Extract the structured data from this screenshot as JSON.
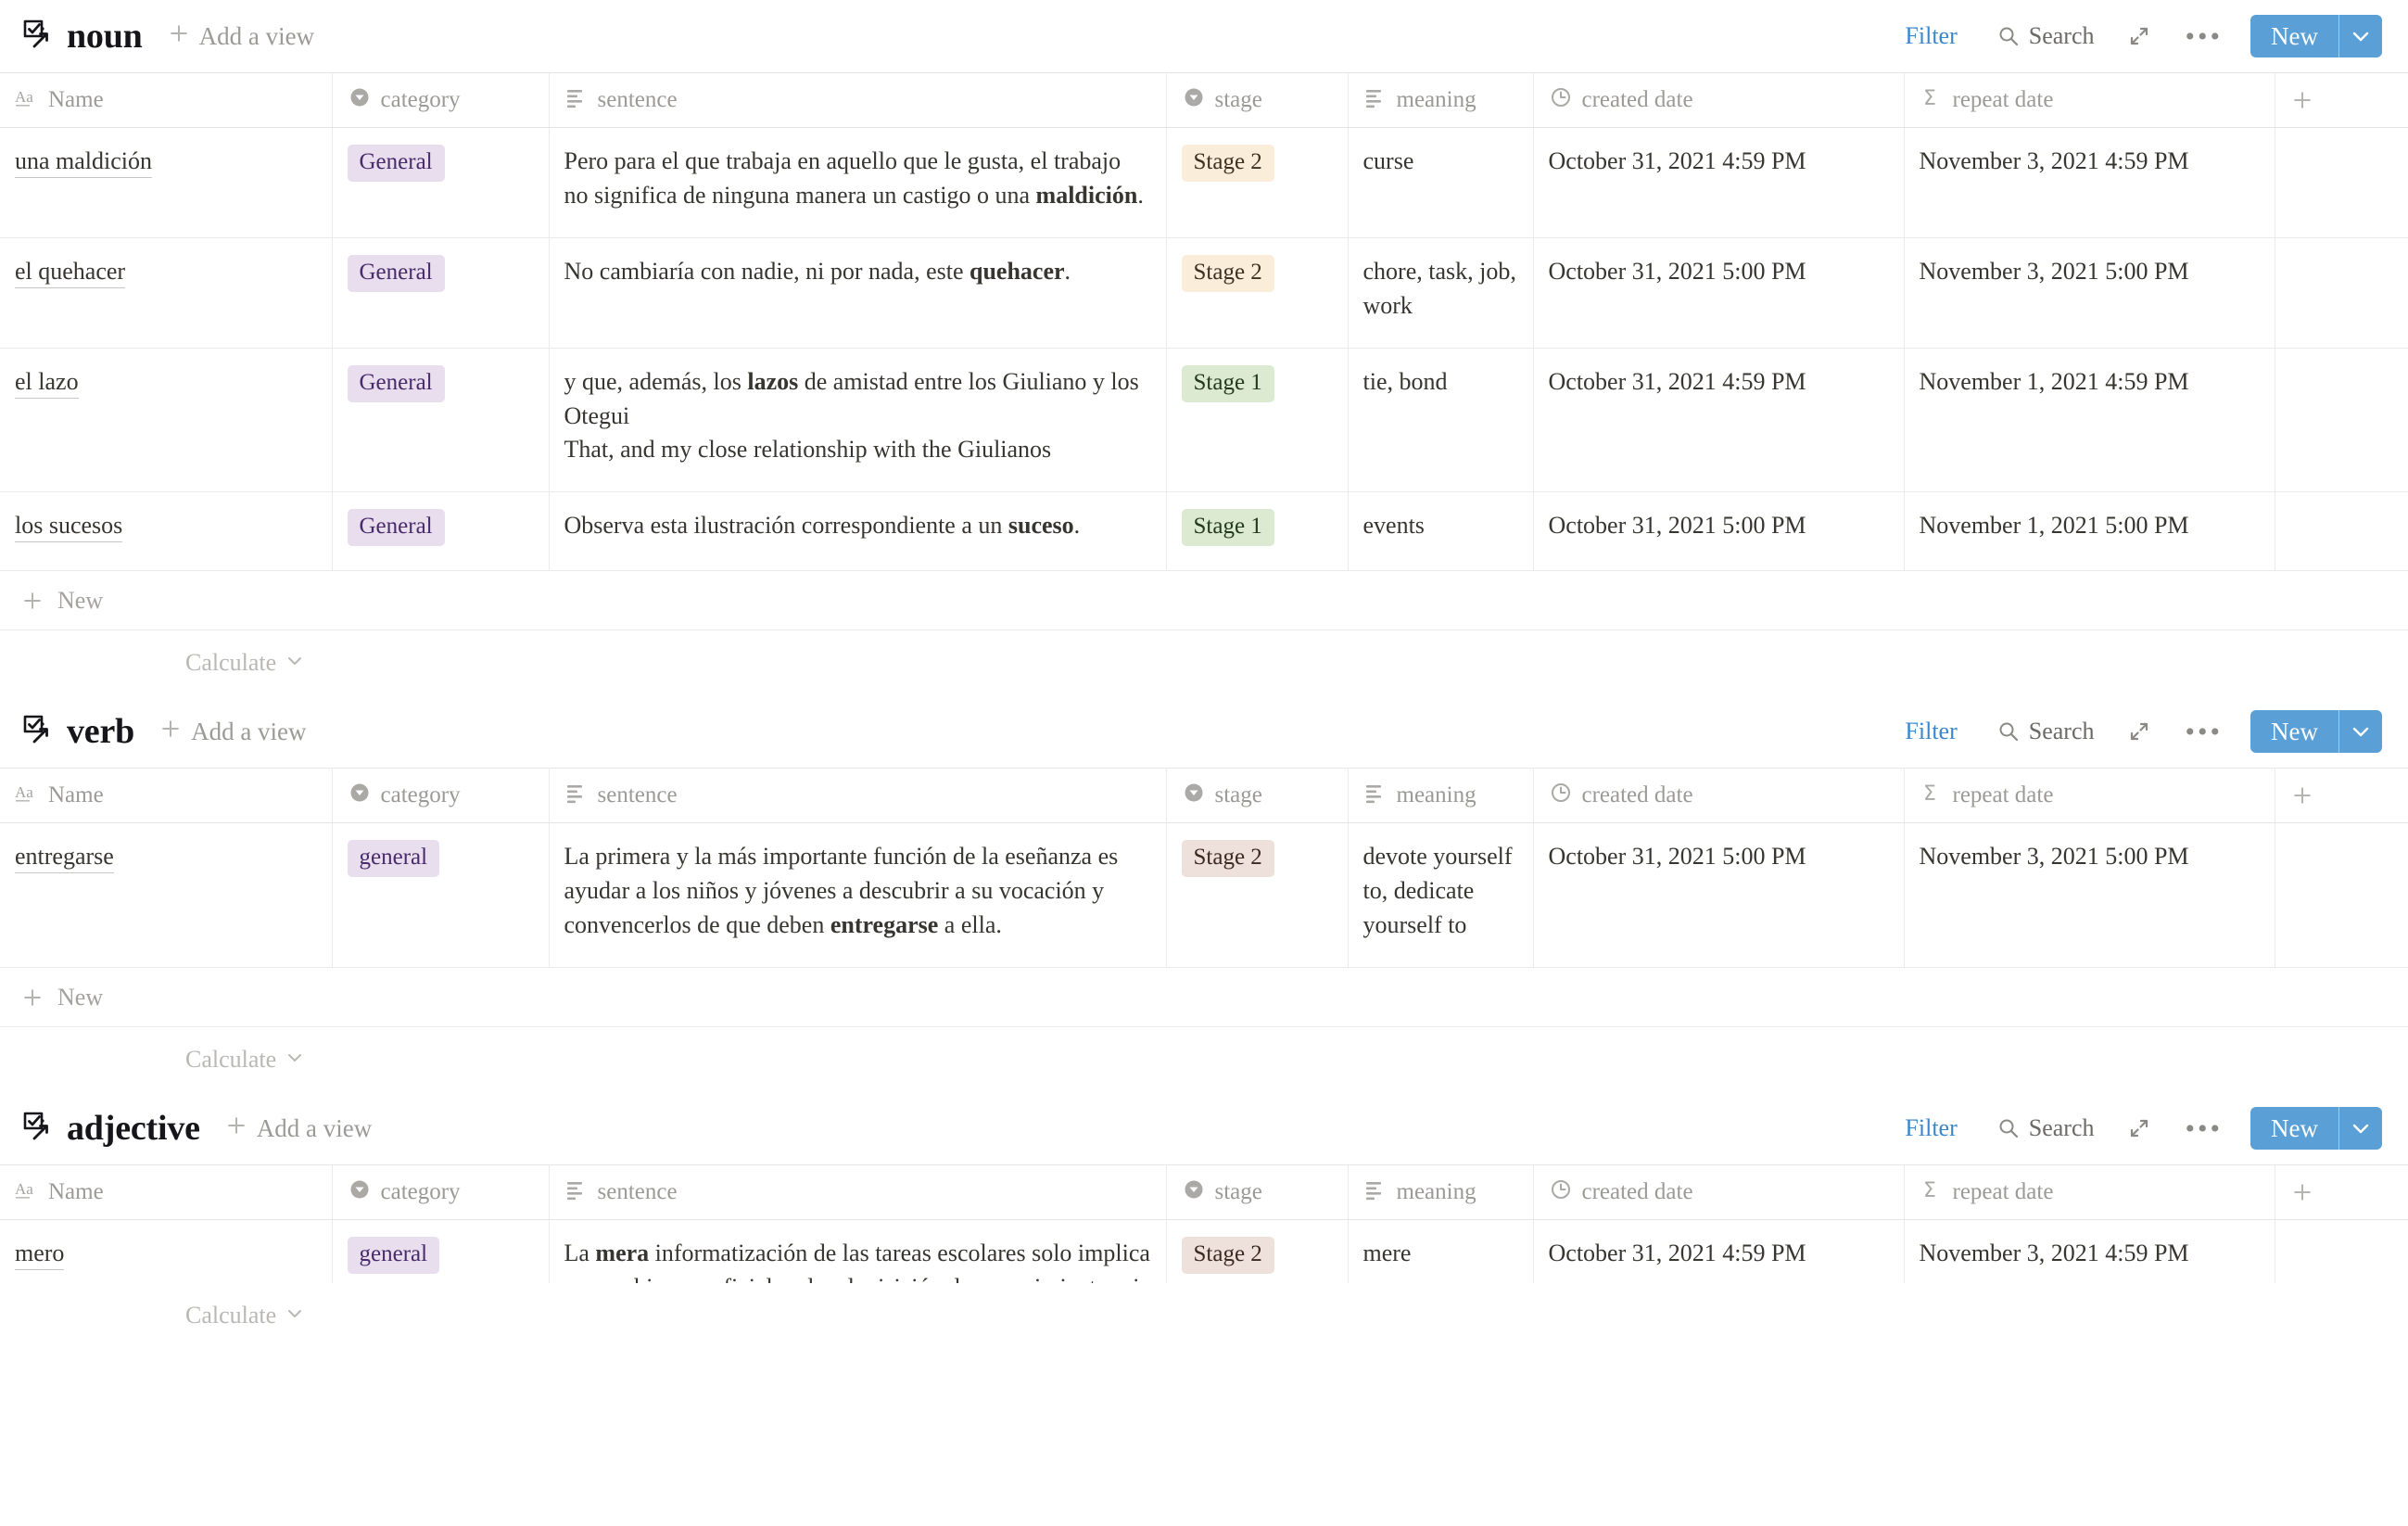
{
  "columns": {
    "name": "Name",
    "category": "category",
    "sentence": "sentence",
    "stage": "stage",
    "meaning": "meaning",
    "created_date": "created date",
    "repeat_date": "repeat date"
  },
  "icon_names": {
    "database": "database-link-icon",
    "text_type": "text-type-icon",
    "select_type": "select-type-icon",
    "multiline_type": "multiline-text-icon",
    "clock": "clock-icon",
    "formula": "formula-sigma-icon",
    "search": "search-icon",
    "expand": "expand-arrows-icon",
    "more": "more-options-icon",
    "chevron": "chevron-down-icon",
    "plus": "plus-icon"
  },
  "toolbar": {
    "filter": "Filter",
    "search": "Search",
    "more": "•••",
    "new": "New"
  },
  "add_view": "Add a view",
  "new_row_label": "New",
  "calculate_label": "Calculate",
  "colors": {
    "accent_blue": "#5aa0d6",
    "filter_blue": "#3b87c9",
    "tag_purple_bg": "#e8deee",
    "tag_purple_fg": "#492a6b",
    "tag_yellow_bg": "#faeedb",
    "tag_green_bg": "#dcead2",
    "tag_beige_bg": "#eee0da",
    "text": "#37352f",
    "muted": "#9b9a97",
    "border": "#eceae8"
  },
  "sections": [
    {
      "title": "noun",
      "rows": [
        {
          "name": "una maldición",
          "category": "General",
          "category_style": "purple",
          "sentence_parts": [
            {
              "t": "Pero para el que trabaja en aquello que le gusta, el trabajo no significa de ninguna manera un castigo o una ",
              "b": false
            },
            {
              "t": "maldición",
              "b": true
            },
            {
              "t": ".",
              "b": false
            }
          ],
          "stage": "Stage 2",
          "stage_style": "yellow",
          "meaning": "curse",
          "created_date": "October 31, 2021 4:59 PM",
          "repeat_date": "November 3, 2021 4:59 PM"
        },
        {
          "name": "el quehacer",
          "category": "General",
          "category_style": "purple",
          "sentence_parts": [
            {
              "t": "No cambiaría con nadie, ni por nada, este ",
              "b": false
            },
            {
              "t": "quehacer",
              "b": true
            },
            {
              "t": ".",
              "b": false
            }
          ],
          "stage": "Stage 2",
          "stage_style": "yellow",
          "meaning": "chore, task, job, work",
          "created_date": "October 31, 2021 5:00 PM",
          "repeat_date": "November 3, 2021 5:00 PM"
        },
        {
          "name": "el lazo",
          "category": "General",
          "category_style": "purple",
          "sentence_parts": [
            {
              "t": "y que, además, los ",
              "b": false
            },
            {
              "t": "lazos",
              "b": true
            },
            {
              "t": " de amistad entre los Giuliano y los Otegui\nThat, and my close relationship with the Giulianos",
              "b": false
            }
          ],
          "stage": "Stage 1",
          "stage_style": "green",
          "meaning": "tie, bond",
          "created_date": "October 31, 2021 4:59 PM",
          "repeat_date": "November 1, 2021 4:59 PM"
        },
        {
          "name": "los sucesos",
          "category": "General",
          "category_style": "purple",
          "sentence_parts": [
            {
              "t": "Observa esta ilustración correspondiente a un ",
              "b": false
            },
            {
              "t": "suceso",
              "b": true
            },
            {
              "t": ".",
              "b": false
            }
          ],
          "stage": "Stage 1",
          "stage_style": "green",
          "meaning": "events",
          "created_date": "October 31, 2021 5:00 PM",
          "repeat_date": "November 1, 2021 5:00 PM"
        }
      ]
    },
    {
      "title": "verb",
      "rows": [
        {
          "name": "entregarse",
          "category": "general",
          "category_style": "purple",
          "sentence_parts": [
            {
              "t": "La primera y la más importante función de la eseñanza es ayudar a los niños y jóvenes a descubrir a su vocación y convencerlos de que deben ",
              "b": false
            },
            {
              "t": "entregarse",
              "b": true
            },
            {
              "t": " a ella.",
              "b": false
            }
          ],
          "stage": "Stage 2",
          "stage_style": "beige",
          "meaning": "devote yourself to, dedicate yourself to",
          "created_date": "October 31, 2021 5:00 PM",
          "repeat_date": "November 3, 2021 5:00 PM"
        }
      ]
    },
    {
      "title": "adjective",
      "rows": [
        {
          "name": "mero",
          "category": "general",
          "category_style": "purple",
          "sentence_parts": [
            {
              "t": "La ",
              "b": false
            },
            {
              "t": "mera",
              "b": true
            },
            {
              "t": " informatización de las tareas escolares solo implica un cambio superficial en la adquisición de conocimientos si",
              "b": false
            }
          ],
          "stage": "Stage 2",
          "stage_style": "beige",
          "meaning": "mere",
          "created_date": "October 31, 2021 4:59 PM",
          "repeat_date": "November 3, 2021 4:59 PM"
        }
      ]
    }
  ]
}
